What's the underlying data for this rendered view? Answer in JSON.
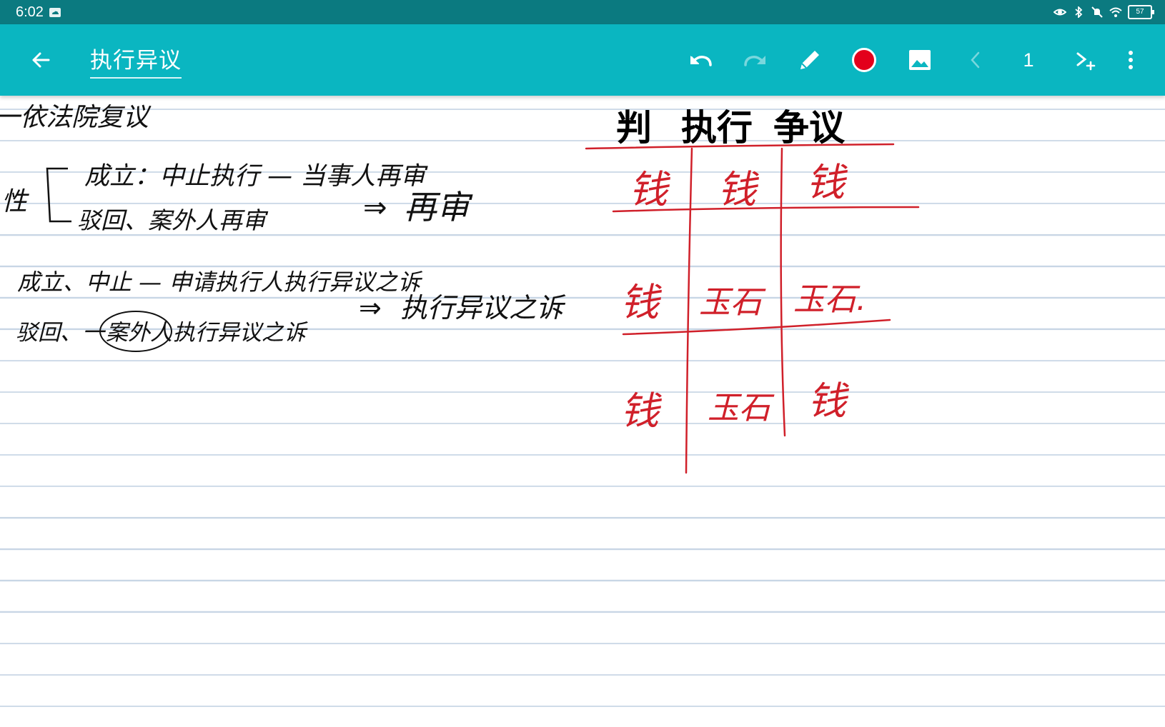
{
  "status_bar": {
    "time": "6:02",
    "battery": "57",
    "icons": [
      "cloud-icon",
      "eye-icon",
      "bluetooth-icon",
      "mute-icon",
      "wifi-icon",
      "battery-icon"
    ]
  },
  "app_bar": {
    "title": "执行异议",
    "page_number": "1",
    "pen_color": "#e3001b",
    "background": "#0ab6c1",
    "icons": [
      "back-arrow-icon",
      "undo-icon",
      "redo-icon",
      "pen-icon",
      "image-icon",
      "chevron-left-icon",
      "add-page-icon",
      "more-vertical-icon"
    ]
  },
  "note": {
    "left_notes": {
      "line1": "一依法院复议",
      "bracket_label": "性",
      "line2": "成立：中止执行 — 当事人再审",
      "line3": "驳回、案外人再审",
      "arrow1": "⇒",
      "result1": "再审",
      "line4": "成立、中止 — 申请执行人执行异议之诉",
      "line5a": "驳回、一",
      "line5b": "案外人",
      "line5c": "执行异议之诉",
      "arrow2": "⇒",
      "result2": "执行异议之诉"
    },
    "table": {
      "headers": [
        "判",
        "执行",
        "争议"
      ],
      "rows": [
        [
          "钱",
          "钱",
          "钱"
        ],
        [
          "钱",
          "玉石",
          "玉石."
        ],
        [
          "钱",
          "玉石",
          "钱"
        ]
      ]
    }
  }
}
